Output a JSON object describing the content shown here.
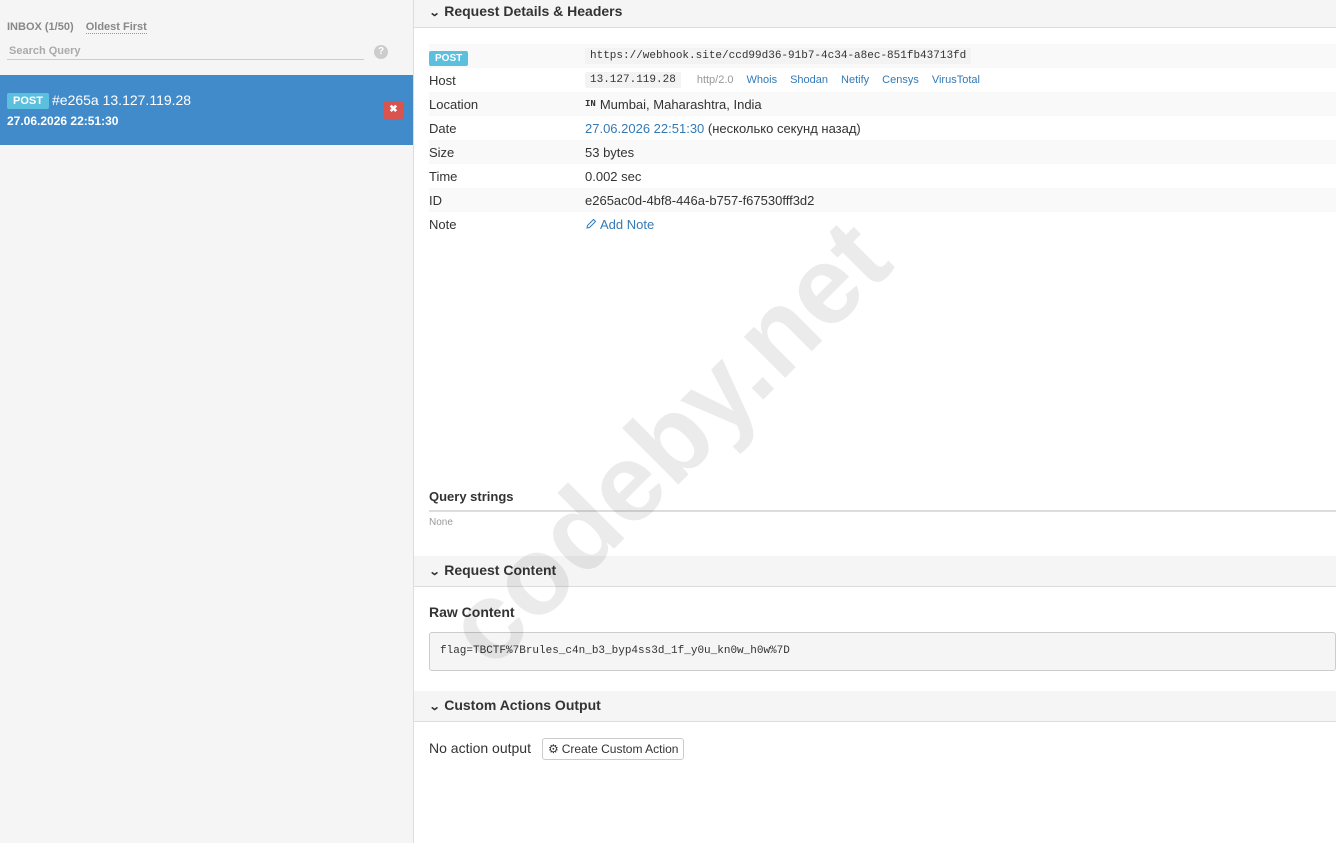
{
  "sidebar": {
    "inbox_label": "INBOX (1/50)",
    "sort_label": "Oldest First",
    "search_placeholder": "Search Query",
    "help": "?",
    "request": {
      "method": "POST",
      "title": "#e265a 13.127.119.28",
      "date": "27.06.2026 22:51:30",
      "delete": "✖"
    }
  },
  "details": {
    "header": "Request Details & Headers",
    "method": "POST",
    "url": "https://webhook.site/ccd99d36-91b7-4c34-a8ec-851fb43713fd",
    "host_label": "Host",
    "host_ip": "13.127.119.28",
    "protocol": "http/2.0",
    "links": [
      "Whois",
      "Shodan",
      "Netify",
      "Censys",
      "VirusTotal"
    ],
    "location_label": "Location",
    "location_flag": "IN",
    "location": "Mumbai, Maharashtra, India",
    "date_label": "Date",
    "date_value": "27.06.2026 22:51:30",
    "date_relative": "(несколько секунд назад)",
    "size_label": "Size",
    "size_value": "53 bytes",
    "time_label": "Time",
    "time_value": "0.002 sec",
    "id_label": "ID",
    "id_value": "e265ac0d-4bf8-446a-b757-f67530fff3d2",
    "note_label": "Note",
    "add_note": "Add Note"
  },
  "query_strings": {
    "title": "Query strings",
    "value": "None"
  },
  "content": {
    "header": "Request Content",
    "raw_title": "Raw Content",
    "raw_value": "flag=TBCTF%7Brules_c4n_b3_byp4ss3d_1f_y0u_kn0w_h0w%7D"
  },
  "actions": {
    "header": "Custom Actions Output",
    "no_output": "No action output",
    "create_button": "Create Custom Action"
  },
  "watermark": "codeby.net"
}
